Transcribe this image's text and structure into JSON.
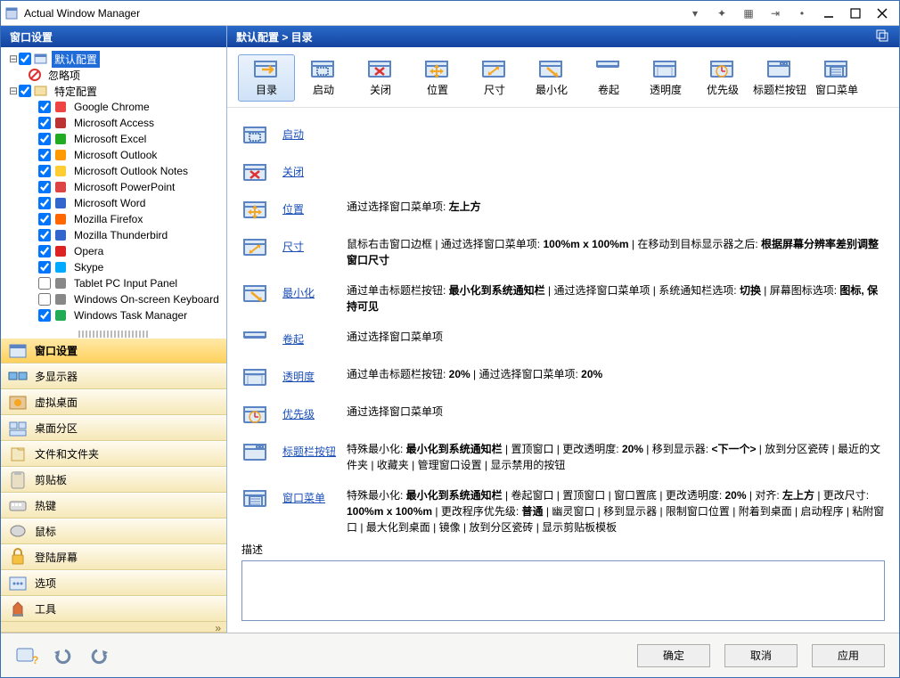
{
  "app_title": "Actual Window Manager",
  "titlebar_glyphs": [
    "▾",
    "✦",
    "▦",
    "⇥",
    "•"
  ],
  "left_header": "窗口设置",
  "breadcrumb": "默认配置 > 目录",
  "tree": {
    "root": {
      "label": "默认配置",
      "selected": true
    },
    "ignore": {
      "label": "忽略项"
    },
    "specific": {
      "label": "特定配置"
    },
    "apps": [
      {
        "label": "Google Chrome",
        "checked": true,
        "color": "#e44"
      },
      {
        "label": "Microsoft Access",
        "checked": true,
        "color": "#b33"
      },
      {
        "label": "Microsoft Excel",
        "checked": true,
        "color": "#2a2"
      },
      {
        "label": "Microsoft Outlook",
        "checked": true,
        "color": "#f90"
      },
      {
        "label": "Microsoft Outlook Notes",
        "checked": true,
        "color": "#fc3"
      },
      {
        "label": "Microsoft PowerPoint",
        "checked": true,
        "color": "#d44"
      },
      {
        "label": "Microsoft Word",
        "checked": true,
        "color": "#36c"
      },
      {
        "label": "Mozilla Firefox",
        "checked": true,
        "color": "#f60"
      },
      {
        "label": "Mozilla Thunderbird",
        "checked": true,
        "color": "#36c"
      },
      {
        "label": "Opera",
        "checked": true,
        "color": "#d22"
      },
      {
        "label": "Skype",
        "checked": true,
        "color": "#0af"
      },
      {
        "label": "Tablet PC Input Panel",
        "checked": false,
        "color": "#888"
      },
      {
        "label": "Windows On-screen Keyboard",
        "checked": false,
        "color": "#888"
      },
      {
        "label": "Windows Task Manager",
        "checked": true,
        "color": "#2a5"
      }
    ]
  },
  "nav": [
    {
      "label": "窗口设置",
      "selected": true
    },
    {
      "label": "多显示器"
    },
    {
      "label": "虚拟桌面"
    },
    {
      "label": "桌面分区"
    },
    {
      "label": "文件和文件夹"
    },
    {
      "label": "剪贴板"
    },
    {
      "label": "热键"
    },
    {
      "label": "鼠标"
    },
    {
      "label": "登陆屏幕"
    },
    {
      "label": "选项"
    },
    {
      "label": "工具"
    }
  ],
  "toolbar": [
    {
      "label": "目录",
      "selected": true
    },
    {
      "label": "启动"
    },
    {
      "label": "关闭"
    },
    {
      "label": "位置"
    },
    {
      "label": "尺寸"
    },
    {
      "label": "最小化"
    },
    {
      "label": "卷起"
    },
    {
      "label": "透明度"
    },
    {
      "label": "优先级"
    },
    {
      "label": "标题栏按钮"
    },
    {
      "label": "窗口菜单"
    }
  ],
  "rows": {
    "startup": {
      "link": "启动",
      "text": ""
    },
    "close": {
      "link": "关闭",
      "text": ""
    },
    "position": {
      "link": "位置",
      "html": "通过选择窗口菜单项: <b>左上方</b>"
    },
    "size": {
      "link": "尺寸",
      "html": "鼠标右击窗口边框 | 通过选择窗口菜单项: <b>100%m x 100%m</b> | 在移动到目标显示器之后: <b>根据屏幕分辨率差别调整窗口尺寸</b>"
    },
    "minimize": {
      "link": "最小化",
      "html": "通过单击标题栏按钮: <b>最小化到系统通知栏</b> | 通过选择窗口菜单项 | 系统通知栏选项: <b>切换</b> | 屏幕图标选项: <b>图标, 保持可见</b>"
    },
    "rollup": {
      "link": "卷起",
      "html": "通过选择窗口菜单项"
    },
    "transparency": {
      "link": "透明度",
      "html": "通过单击标题栏按钮: <b>20%</b> | 通过选择窗口菜单项: <b>20%</b>"
    },
    "priority": {
      "link": "优先级",
      "html": "通过选择窗口菜单项"
    },
    "titlebuttons": {
      "link": "标题栏按钮",
      "html": "特殊最小化: <b>最小化到系统通知栏</b> | 置顶窗口 | 更改透明度: <b>20%</b> | 移到显示器: <b>&lt;下一个&gt;</b> | 放到分区瓷砖 | 最近的文件夹 | 收藏夹 | 管理窗口设置 | 显示禁用的按钮"
    },
    "windowmenu": {
      "link": "窗口菜单",
      "html": "特殊最小化: <b>最小化到系统通知栏</b> | 卷起窗口 | 置顶窗口 | 窗口置底 | 更改透明度: <b>20%</b> | 对齐: <b>左上方</b> | 更改尺寸: <b>100%m x 100%m</b> | 更改程序优先级: <b>普通</b> | 幽灵窗口 | 移到显示器 | 限制窗口位置 | 附着到桌面 | 启动程序 | 粘附窗口 | 最大化到桌面 | 镜像 | 放到分区瓷砖 | 显示剪贴板模板"
    }
  },
  "desc_label": "描述",
  "footer": {
    "ok": "确定",
    "cancel": "取消",
    "apply": "应用"
  }
}
